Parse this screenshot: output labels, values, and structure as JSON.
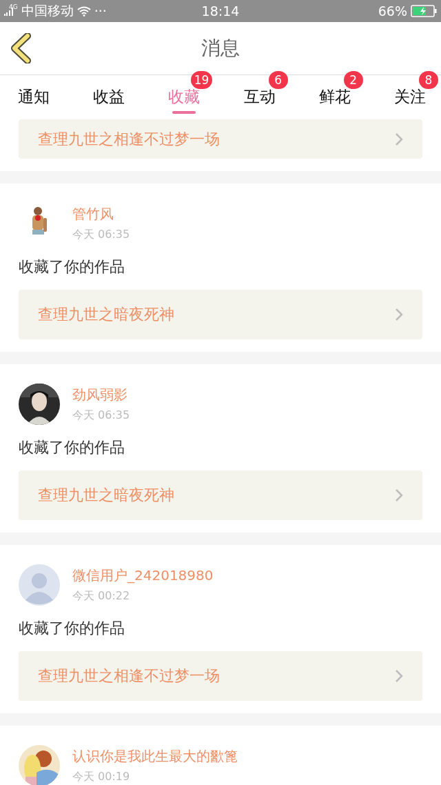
{
  "status_bar": {
    "network": "4G",
    "carrier": "中国移动",
    "more": "···",
    "time": "18:14",
    "battery": "66%"
  },
  "header": {
    "title": "消息"
  },
  "tabs": [
    {
      "label": "通知",
      "selected": false
    },
    {
      "label": "收益",
      "selected": false
    },
    {
      "label": "收藏",
      "selected": true,
      "badge": "19"
    },
    {
      "label": "互动",
      "selected": false,
      "badge": "6"
    },
    {
      "label": "鲜花",
      "selected": false,
      "badge": "2"
    },
    {
      "label": "关注",
      "selected": false,
      "badge": "8"
    }
  ],
  "items": [
    {
      "kind": "partial",
      "work": "查理九世之相逢不过梦一场"
    },
    {
      "kind": "full",
      "name": "管竹风",
      "time": "今天 06:35",
      "action": "收藏了你的作品",
      "work": "查理九世之暗夜死神"
    },
    {
      "kind": "full",
      "name": "劲风弱影",
      "time": "今天 06:35",
      "action": "收藏了你的作品",
      "work": "查理九世之暗夜死神"
    },
    {
      "kind": "full",
      "avatar": {
        "kind": "default"
      },
      "name": "微信用户_242018980",
      "time": "今天 00:22",
      "action": "收藏了你的作品",
      "work": "查理九世之相逢不过梦一场"
    },
    {
      "kind": "full",
      "name": "认识你是我此生最大的歠篦",
      "time": "今天 00:19"
    }
  ]
}
